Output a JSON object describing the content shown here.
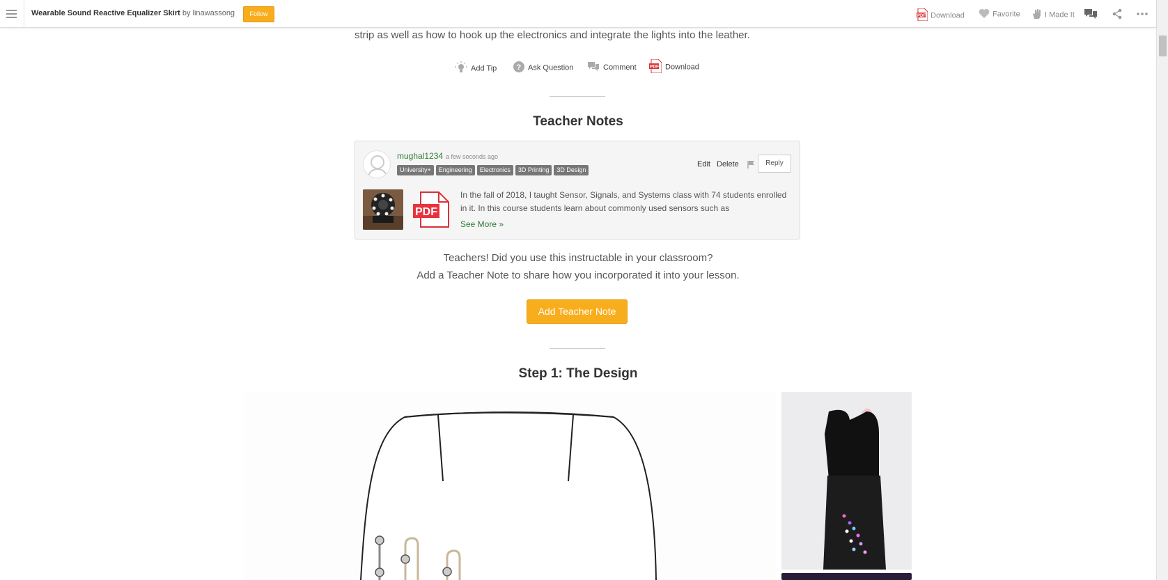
{
  "topbar": {
    "title": "Wearable Sound Reactive Equalizer Skirt",
    "by_prefix": "by ",
    "author": "linawassong",
    "follow_label": "Follow",
    "actions": {
      "download": "Download",
      "favorite": "Favorite",
      "made_it": "I Made It"
    },
    "icons": [
      "menu-icon",
      "pdf-icon",
      "heart-icon",
      "hand-icon",
      "comments-icon",
      "share-icon",
      "more-icon"
    ]
  },
  "intro": {
    "text": "strip as well as how to hook up the electronics and integrate the lights into the leather."
  },
  "action_row": {
    "add_tip": "Add Tip",
    "ask_question": "Ask Question",
    "comment": "Comment",
    "download": "Download"
  },
  "teacher_notes": {
    "heading": "Teacher Notes",
    "note": {
      "username": "mughal1234",
      "time": "a few seconds ago",
      "tags": [
        "University+",
        "Engineering",
        "Electronics",
        "3D Printing",
        "3D Design"
      ],
      "edit": "Edit",
      "delete": "Delete",
      "reply": "Reply",
      "text": "In the fall of 2018, I taught Sensor, Signals, and Systems class with 74 students enrolled in it. In this course students learn about commonly used sensors such as",
      "see_more": "See More »"
    },
    "prompt_line1": "Teachers! Did you use this instructable in your classroom?",
    "prompt_line2": "Add a Teacher Note to share how you incorporated it into your lesson.",
    "add_button": "Add Teacher Note"
  },
  "step1": {
    "heading": "Step 1: The Design"
  },
  "colors": {
    "accent": "#f8ad1c",
    "link_green": "#2f7c34",
    "tag_gray": "#777777"
  }
}
